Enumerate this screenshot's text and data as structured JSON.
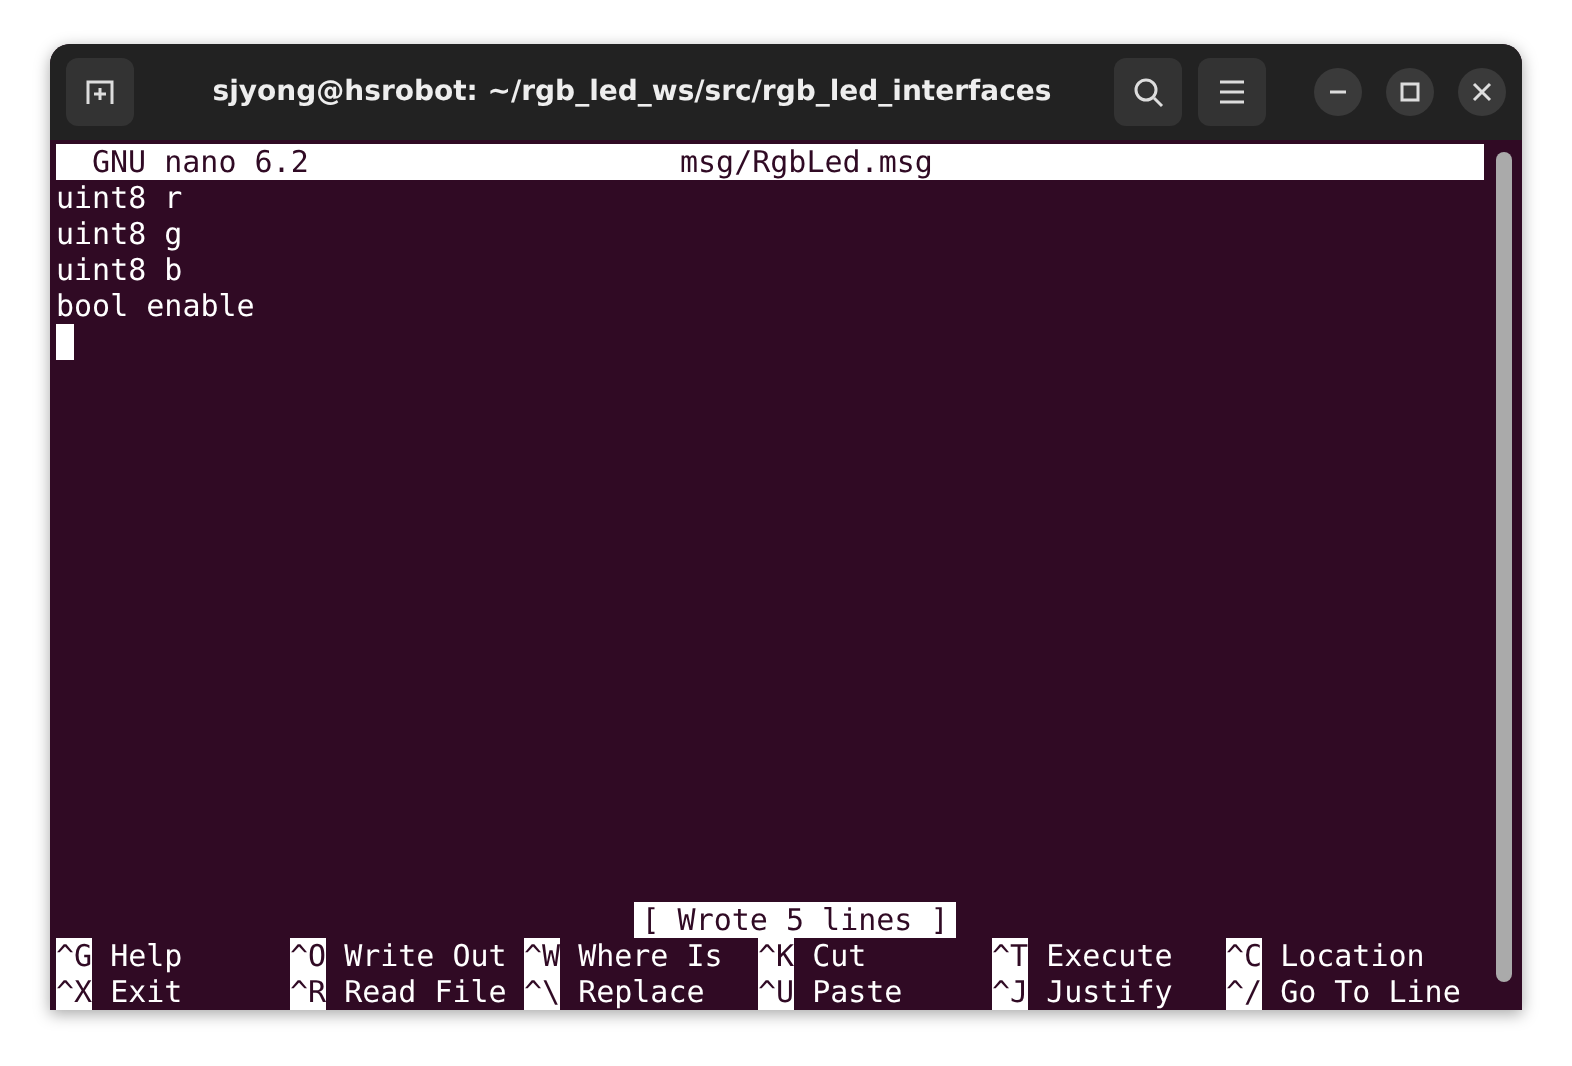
{
  "window": {
    "title": "sjyong@hsrobot: ~/rgb_led_ws/src/rgb_led_interfaces"
  },
  "nano": {
    "version": "GNU nano 6.2",
    "filename": "msg/RgbLed.msg"
  },
  "lines": [
    "uint8 r",
    "uint8 g",
    "uint8 b",
    "bool enable"
  ],
  "status": "[ Wrote 5 lines ]",
  "shortcuts": [
    [
      {
        "key": "^G",
        "label": "Help"
      },
      {
        "key": "^O",
        "label": "Write Out"
      },
      {
        "key": "^W",
        "label": "Where Is"
      },
      {
        "key": "^K",
        "label": "Cut"
      },
      {
        "key": "^T",
        "label": "Execute"
      },
      {
        "key": "^C",
        "label": "Location"
      }
    ],
    [
      {
        "key": "^X",
        "label": "Exit"
      },
      {
        "key": "^R",
        "label": "Read File"
      },
      {
        "key": "^\\",
        "label": "Replace"
      },
      {
        "key": "^U",
        "label": "Paste"
      },
      {
        "key": "^J",
        "label": "Justify"
      },
      {
        "key": "^/",
        "label": "Go To Line"
      }
    ]
  ]
}
